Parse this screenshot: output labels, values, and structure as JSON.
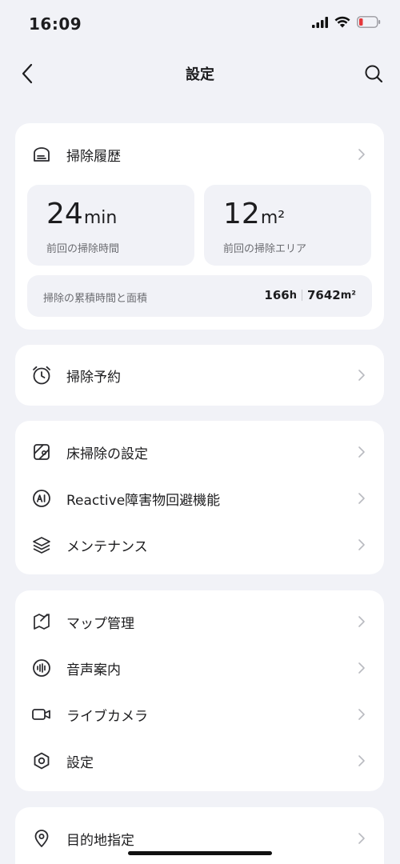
{
  "status_bar": {
    "time": "16:09"
  },
  "nav": {
    "title": "設定"
  },
  "history": {
    "title": "掃除履歴",
    "last_time": {
      "value": "24",
      "unit": "min",
      "label": "前回の掃除時間"
    },
    "last_area": {
      "value": "12",
      "unit": "m²",
      "label": "前回の掃除エリア"
    },
    "total": {
      "label": "掃除の累積時間と面積",
      "hours": "166",
      "hours_unit": "h",
      "area": "7642",
      "area_unit": "m²"
    }
  },
  "schedule": {
    "label": "掃除予約"
  },
  "group_cleaning": [
    {
      "label": "床掃除の設定",
      "icon": "floor-cleaning-icon"
    },
    {
      "label": "Reactive障害物回避機能",
      "icon": "ai-icon"
    },
    {
      "label": "メンテナンス",
      "icon": "layers-icon"
    }
  ],
  "group_device": [
    {
      "label": "マップ管理",
      "icon": "map-icon"
    },
    {
      "label": "音声案内",
      "icon": "voice-icon"
    },
    {
      "label": "ライブカメラ",
      "icon": "camera-icon"
    },
    {
      "label": "設定",
      "icon": "hexagon-settings-icon"
    }
  ],
  "group_nav": [
    {
      "label": "目的地指定",
      "icon": "location-pin-icon"
    }
  ],
  "colors": {
    "background": "#f1f2f7",
    "card": "#ffffff",
    "battery_low": "#e5383b"
  }
}
